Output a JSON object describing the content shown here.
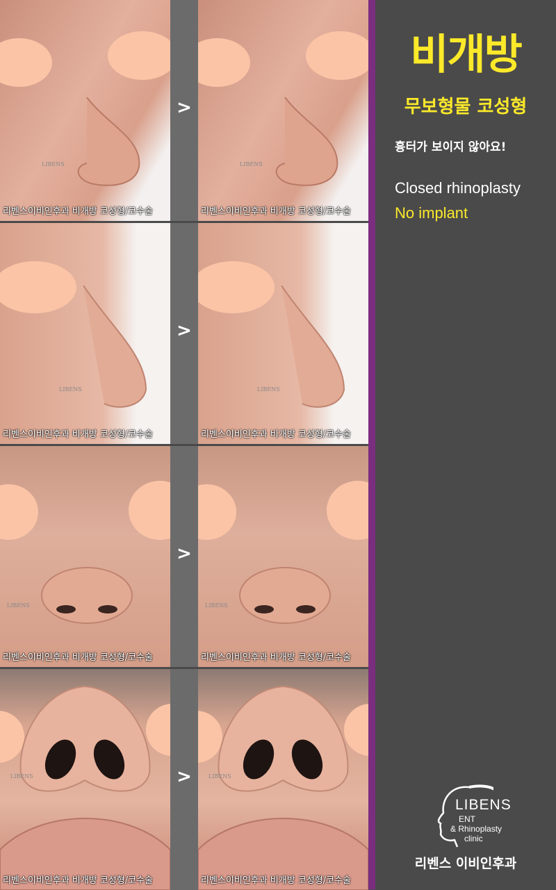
{
  "rows": [
    {
      "arrow": ">",
      "before_caption": "리벤스이비인후과 비개방 코성형/코수술",
      "after_caption": "리벤스이비인후과 비개방 코성형/코수술",
      "watermark": "LIBENS"
    },
    {
      "arrow": ">",
      "before_caption": "리벤스이비인후과 비개방 코성형/코수술",
      "after_caption": "리벤스이비인후과 비개방 코성형/코수술",
      "watermark": "LIBENS"
    },
    {
      "arrow": ">",
      "before_caption": "리벤스이비인후과 비개방 코성형/코수술",
      "after_caption": "리벤스이비인후과 비개방 코성형/코수술",
      "watermark": "LIBENS"
    },
    {
      "arrow": ">",
      "before_caption": "리벤스이비인후과 비개방 코성형/코수술",
      "after_caption": "리벤스이비인후과 비개방 코성형/코수술",
      "watermark": "LIBENS"
    }
  ],
  "panel": {
    "title": "비개방",
    "subtitle": "무보형물 코성형",
    "note": "흉터가 보이지 않아요!",
    "english_line1": "Closed rhinoplasty",
    "english_line2": "No implant"
  },
  "logo": {
    "brand": "LIBENS",
    "line1": "ENT",
    "line2": "& Rhinoplasty",
    "line3": "clinic",
    "clinic_name": "리벤스 이비인후과"
  },
  "colors": {
    "accent_yellow": "#fbe92a",
    "divider_purple": "#7b2d7f",
    "panel_bg": "#4a4a4a",
    "gap_bg": "#6b6b6b",
    "eye_patch": "#fbc4a6"
  }
}
